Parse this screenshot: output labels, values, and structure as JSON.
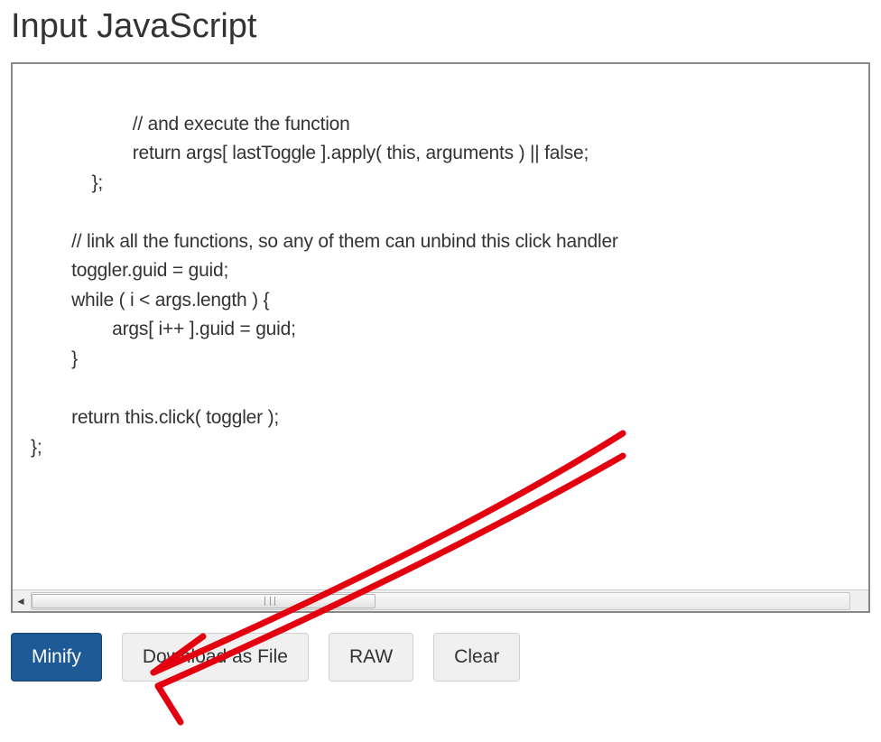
{
  "heading": "Input JavaScript",
  "code": "\n                    // and execute the function\n                    return args[ lastToggle ].apply( this, arguments ) || false;\n            };\n\n        // link all the functions, so any of them can unbind this click handler\n        toggler.guid = guid;\n        while ( i < args.length ) {\n                args[ i++ ].guid = guid;\n        }\n\n        return this.click( toggler );\n};",
  "buttons": {
    "minify": "Minify",
    "download": "Download as File",
    "raw": "RAW",
    "clear": "Clear"
  }
}
